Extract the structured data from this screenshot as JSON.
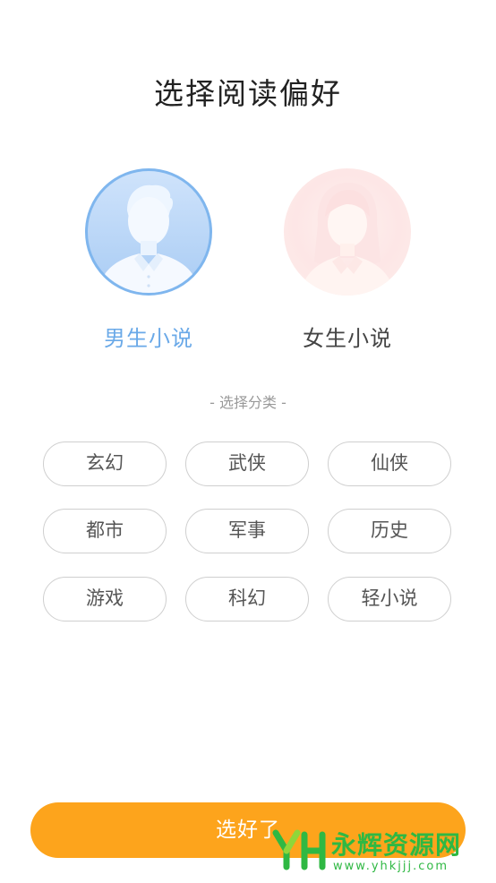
{
  "header": {
    "title": "选择阅读偏好"
  },
  "genders": [
    {
      "label": "男生小说",
      "selected": true,
      "accent": "#6aa9e8"
    },
    {
      "label": "女生小说",
      "selected": false
    }
  ],
  "category_section": {
    "subtitle": "- 选择分类 -",
    "chips": [
      "玄幻",
      "武侠",
      "仙侠",
      "都市",
      "军事",
      "历史",
      "游戏",
      "科幻",
      "轻小说"
    ]
  },
  "footer": {
    "confirm_label": "选好了",
    "confirm_color": "#fda41c"
  },
  "watermark": {
    "name": "永辉资源网",
    "url": "www.yhkjjj.com",
    "color": "#2fb843"
  }
}
